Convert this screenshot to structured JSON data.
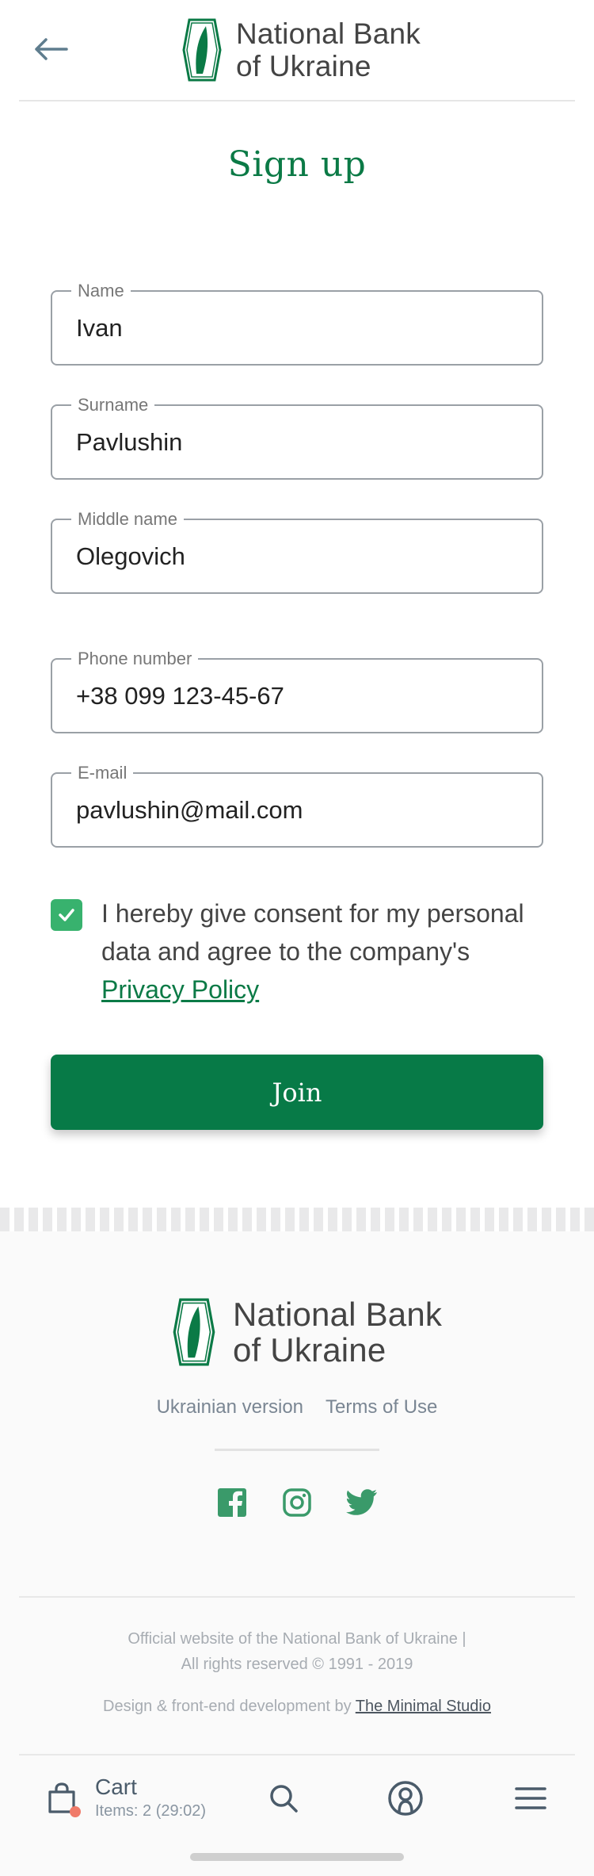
{
  "header": {
    "bank_name_line1": "National Bank",
    "bank_name_line2": "of Ukraine"
  },
  "page": {
    "title": "Sign up"
  },
  "form": {
    "fields": [
      {
        "label": "Name",
        "value": "Ivan"
      },
      {
        "label": "Surname",
        "value": "Pavlushin"
      },
      {
        "label": "Middle name",
        "value": "Olegovich"
      },
      {
        "label": "Phone number",
        "value": "+38 099 123-45-67"
      },
      {
        "label": "E-mail",
        "value": "pavlushin@mail.com"
      }
    ],
    "consent_text": "I hereby give consent for my personal data and agree to the company's",
    "consent_link": "Privacy Policy",
    "consent_checked": true,
    "join_label": "Join"
  },
  "footer": {
    "bank_name_line1": "National Bank",
    "bank_name_line2": "of Ukraine",
    "links": [
      "Ukrainian version",
      "Terms of Use"
    ],
    "socials": [
      "facebook-icon",
      "instagram-icon",
      "twitter-icon"
    ],
    "legal_line1": "Official website of the National Bank of Ukraine |",
    "legal_line2": "All rights reserved © 1991 - 2019",
    "credit_prefix": "Design & front-end development by",
    "credit_link": "The Minimal Studio"
  },
  "bottom_nav": {
    "cart_label": "Cart",
    "cart_items": "Items: 2 (29:02)",
    "icons": [
      "cart-icon",
      "search-icon",
      "profile-icon",
      "menu-icon"
    ]
  },
  "colors": {
    "brand_green": "#077a47",
    "checkbox_green": "#38b26e",
    "cart_badge": "#f07b6a"
  }
}
